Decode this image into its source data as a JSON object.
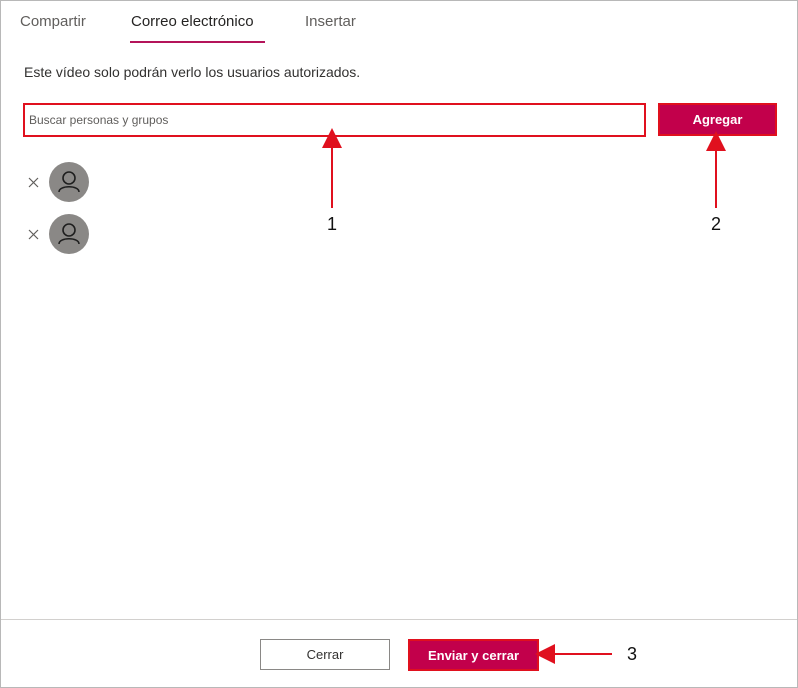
{
  "tabs": [
    {
      "label": "Compartir",
      "active": false
    },
    {
      "label": "Correo electrónico",
      "active": true
    },
    {
      "label": "Insertar",
      "active": false
    }
  ],
  "description": "Este vídeo solo podrán verlo los usuarios autorizados.",
  "search": {
    "placeholder": "Buscar personas y grupos",
    "value": ""
  },
  "add_button": {
    "label": "Agregar"
  },
  "people": [
    {
      "remove_icon": "close-icon",
      "avatar_icon": "person-icon"
    },
    {
      "remove_icon": "close-icon",
      "avatar_icon": "person-icon"
    }
  ],
  "footer": {
    "close_label": "Cerrar",
    "send_label": "Enviar y cerrar"
  },
  "annotations": {
    "one": "1",
    "two": "2",
    "three": "3"
  },
  "colors": {
    "accent": "#c2004b",
    "annotation": "#e0101e",
    "avatar": "#8a8886"
  }
}
